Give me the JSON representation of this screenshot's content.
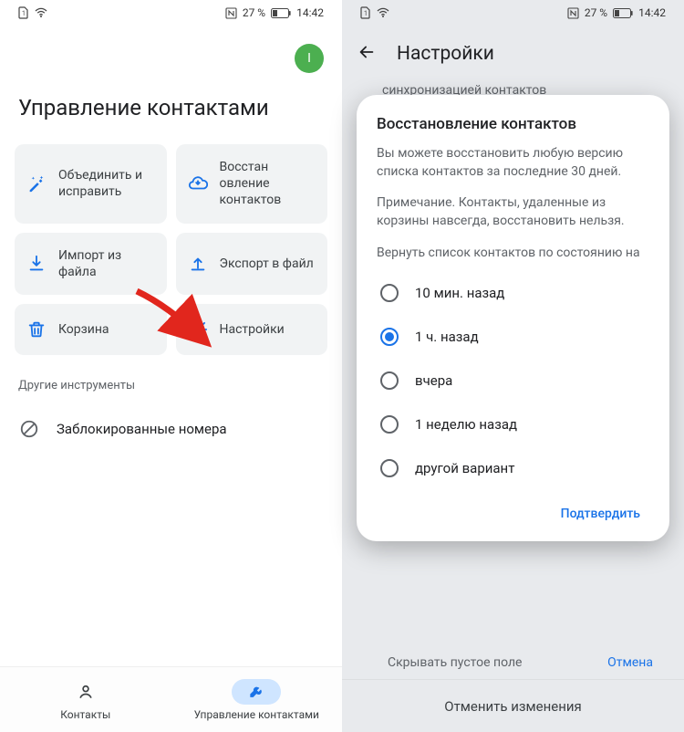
{
  "status": {
    "battery": "27 %",
    "time": "14:42"
  },
  "left": {
    "avatar": "I",
    "title": "Управление контактами",
    "actions": [
      {
        "label": "Объединить и исправить"
      },
      {
        "label": "Восстан овление контактов"
      },
      {
        "label": "Импорт из файла"
      },
      {
        "label": "Экспорт в файл"
      },
      {
        "label": "Корзина"
      },
      {
        "label": "Настройки"
      }
    ],
    "other_tools": "Другие инструменты",
    "blocked": "Заблокированные номера",
    "tabs": {
      "contacts": "Контакты",
      "manage": "Управление контактами"
    }
  },
  "right": {
    "header": "Настройки",
    "bg_text": "синхронизацией контактов",
    "dialog": {
      "title": "Восстановление контактов",
      "p1": "Вы можете восстановить любую версию списка контактов за последние 30 дней.",
      "p2": "Примечание. Контакты, удаленные из корзины навсегда, восстановить нельзя.",
      "prompt": "Вернуть список контактов по состоянию на",
      "options": [
        "10 мин. назад",
        "1 ч. назад",
        "вчера",
        "1 неделю назад",
        "другой вариант"
      ],
      "selected": 1,
      "confirm": "Подтвердить"
    },
    "behind_hide": "Скрывать пустое поле",
    "behind_cancel": "Отмена",
    "undo": "Отменить изменения"
  }
}
